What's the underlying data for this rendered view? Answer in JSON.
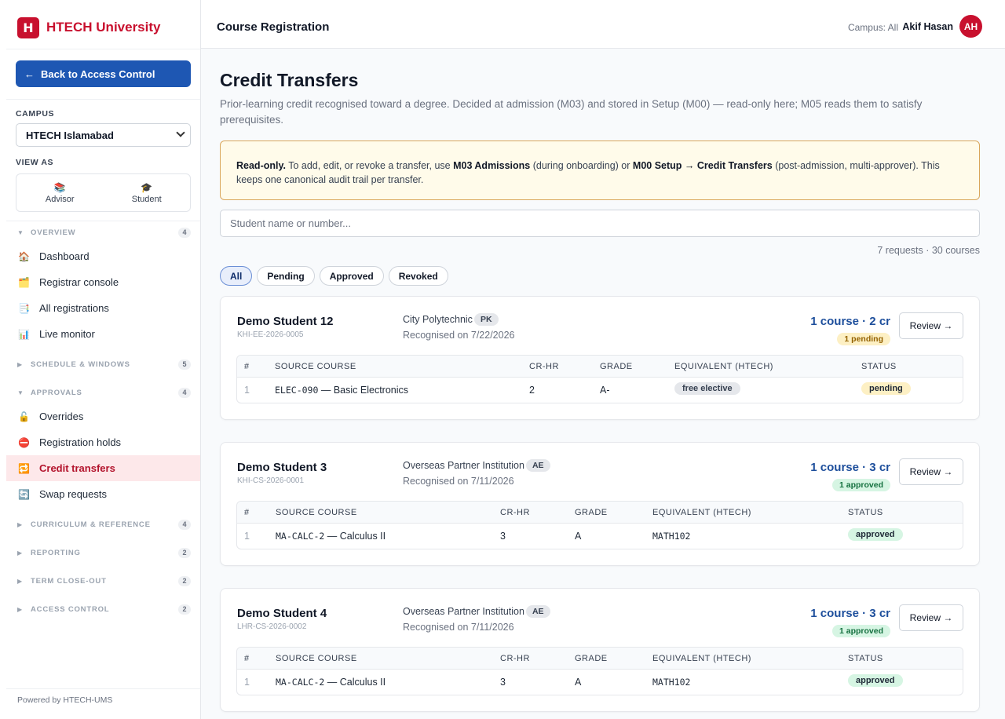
{
  "brand": {
    "logo_letter": "H",
    "name": "HTECH University"
  },
  "sidebar": {
    "back_label": "Back to Access Control",
    "back_arrow": "←",
    "campus_label": "CAMPUS",
    "campus_value": "HTECH Islamabad",
    "view_as_label": "VIEW AS",
    "view_as": [
      {
        "label": "Advisor",
        "icon": "books-icon",
        "glyph": "📚"
      },
      {
        "label": "Student",
        "icon": "graduation-cap-icon",
        "glyph": "🎓"
      }
    ],
    "sections": [
      {
        "label": "OVERVIEW",
        "count": "4",
        "expanded": true
      },
      {
        "label": "SCHEDULE & WINDOWS",
        "count": "5",
        "expanded": false
      },
      {
        "label": "APPROVALS",
        "count": "4",
        "expanded": true
      },
      {
        "label": "CURRICULUM & REFERENCE",
        "count": "4",
        "expanded": false
      },
      {
        "label": "REPORTING",
        "count": "2",
        "expanded": false
      },
      {
        "label": "TERM CLOSE-OUT",
        "count": "2",
        "expanded": false
      },
      {
        "label": "ACCESS CONTROL",
        "count": "2",
        "expanded": false
      }
    ],
    "overview_items": [
      {
        "label": "Dashboard",
        "icon": "house-icon",
        "glyph": "🏠"
      },
      {
        "label": "Registrar console",
        "icon": "folder-icon",
        "glyph": "🗂️"
      },
      {
        "label": "All registrations",
        "icon": "document-icon",
        "glyph": "📑"
      },
      {
        "label": "Live monitor",
        "icon": "bar-chart-icon",
        "glyph": "📊"
      }
    ],
    "approval_items": [
      {
        "label": "Overrides",
        "icon": "unlock-icon",
        "glyph": "🔓"
      },
      {
        "label": "Registration holds",
        "icon": "no-entry-icon",
        "glyph": "⛔"
      },
      {
        "label": "Credit transfers",
        "icon": "transfer-icon",
        "glyph": "🔁",
        "active": true
      },
      {
        "label": "Swap requests",
        "icon": "swap-icon",
        "glyph": "🔄"
      }
    ],
    "powered_by": "Powered by HTECH-UMS"
  },
  "topbar": {
    "page_name": "Course Registration",
    "campus": "Campus: All",
    "user_name": "Akif Hasan",
    "user_initials": "AH"
  },
  "main": {
    "title": "Credit Transfers",
    "subtitle": "Prior-learning credit recognised toward a degree. Decided at admission (M03) and stored in Setup (M00) — read-only here; M05 reads them to satisfy prerequisites.",
    "notice": {
      "bold1": "Read-only.",
      "text1": " To add, edit, or revoke a transfer, use ",
      "bold2": "M03 Admissions",
      "text2": " (during onboarding) or ",
      "bold3": "M00 Setup → Credit Transfers",
      "text3": " (post-admission, multi-approver). This keeps one canonical audit trail per transfer."
    },
    "search_placeholder": "Student name or number...",
    "counts": "7 requests · 30 courses",
    "filters": [
      "All",
      "Pending",
      "Approved",
      "Revoked"
    ],
    "active_filter": "All",
    "table_headers": [
      "#",
      "SOURCE COURSE",
      "CR-HR",
      "GRADE",
      "EQUIVALENT (HTECH)",
      "STATUS"
    ],
    "review_label": "Review →",
    "cards": [
      {
        "student": "Demo Student 12",
        "student_id": "KHI-EE-2026-0005",
        "institution": "City Polytechnic",
        "country": "PK",
        "recognised": "Recognised on 7/22/2026",
        "summary": "1 course · 2 cr",
        "status_summary": "1 pending",
        "status": "pending",
        "rows": [
          {
            "num": "1",
            "code": "ELEC-090",
            "title": " — Basic Electronics",
            "cr": "2",
            "grade": "A-",
            "equivalent": "free elective",
            "equivalent_is_pill": true,
            "status": "pending"
          }
        ]
      },
      {
        "student": "Demo Student 3",
        "student_id": "KHI-CS-2026-0001",
        "institution": "Overseas Partner Institution",
        "country": "AE",
        "recognised": "Recognised on 7/11/2026",
        "summary": "1 course · 3 cr",
        "status_summary": "1 approved",
        "status": "approved",
        "rows": [
          {
            "num": "1",
            "code": "MA-CALC-2",
            "title": " — Calculus II",
            "cr": "3",
            "grade": "A",
            "equivalent": "MATH102",
            "equivalent_is_pill": false,
            "status": "approved"
          }
        ]
      },
      {
        "student": "Demo Student 4",
        "student_id": "LHR-CS-2026-0002",
        "institution": "Overseas Partner Institution",
        "country": "AE",
        "recognised": "Recognised on 7/11/2026",
        "summary": "1 course · 3 cr",
        "status_summary": "1 approved",
        "status": "approved",
        "rows": [
          {
            "num": "1",
            "code": "MA-CALC-2",
            "title": " — Calculus II",
            "cr": "3",
            "grade": "A",
            "equivalent": "MATH102",
            "equivalent_is_pill": false,
            "status": "approved"
          }
        ]
      }
    ]
  },
  "colors": {
    "brand_red": "#c8102e",
    "primary_blue": "#1e57b3",
    "pending": "#946200",
    "approved": "#14703f"
  }
}
